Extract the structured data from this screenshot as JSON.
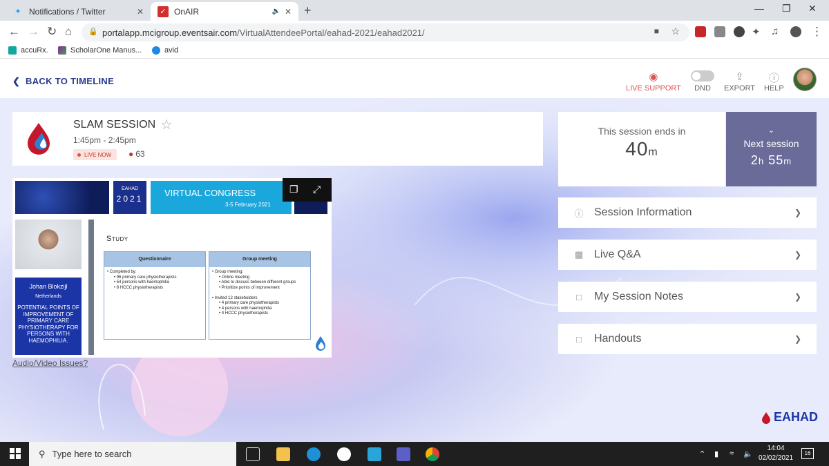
{
  "browser": {
    "tabs": [
      {
        "label": "Notifications / Twitter",
        "icon": "twitter-icon",
        "active": false
      },
      {
        "label": "OnAIR",
        "icon": "onair-icon",
        "active": true
      }
    ],
    "new_tab": "+",
    "url_prefix": "portalapp.mcigroup.eventsair.com",
    "url_rest": "/VirtualAttendeePortal/eahad-2021/eahad2021/",
    "bookmarks": [
      {
        "label": "accuRx.",
        "icon": "accurx-icon"
      },
      {
        "label": "ScholarOne Manus...",
        "icon": "scholarone-icon"
      },
      {
        "label": "avid",
        "icon": "avid-icon"
      }
    ]
  },
  "header": {
    "back_label": "BACK TO TIMELINE",
    "live_support": "LIVE SUPPORT",
    "dnd": "DND",
    "export": "EXPORT",
    "help": "HELP"
  },
  "session": {
    "title": "SLAM SESSION",
    "time": "1:45pm - 2:45pm",
    "live_badge": "LIVE NOW",
    "viewers": "63"
  },
  "video": {
    "banner_eahad": "EAHAD",
    "banner_year": "2021",
    "banner_congress": "VIRTUAL CONGRESS",
    "banner_dates": "3-5 February 2021",
    "speaker_name": "Johan Blokzijl",
    "speaker_country": "Netherlands",
    "speaker_topic": "POTENTIAL POINTS OF IMPROVEMENT OF PRIMARY CARE PHYSIOTHERAPY FOR PERSONS WITH HAEMOPHILIA.",
    "slide_title": "Study",
    "box1_header": "Questionnaire",
    "box1_lines": [
      {
        "text": "• Completed by:",
        "sub": false
      },
      {
        "text": "• 96 primary care physiotherapists",
        "sub": true
      },
      {
        "text": "• 54 persons with haemophilia",
        "sub": true
      },
      {
        "text": "• 8 HCCC physiotherapists",
        "sub": true
      }
    ],
    "box2_header": "Group meeting",
    "box2_lines": [
      {
        "text": "• Group meeting:",
        "sub": false
      },
      {
        "text": "• Online meeting",
        "sub": true
      },
      {
        "text": "• Able to discuss between different groups",
        "sub": true
      },
      {
        "text": "• Prioritize points of improvement",
        "sub": true
      },
      {
        "text": "",
        "sub": false
      },
      {
        "text": "• Invited 12 stakeholders",
        "sub": false
      },
      {
        "text": "• 4 primary care physiotherapists",
        "sub": true
      },
      {
        "text": "• 4 persons with haemophilia",
        "sub": true
      },
      {
        "text": "• 4 HCCC physiotherapists",
        "sub": true
      }
    ]
  },
  "av_issues": "Audio/Video Issues?",
  "timer": {
    "label": "This session ends in",
    "value": "40",
    "unit": "m"
  },
  "next_session": {
    "label": "Next session",
    "hours": "2",
    "minutes": "55",
    "h_unit": "h",
    "m_unit": "m"
  },
  "accordion": [
    {
      "label": "Session Information",
      "icon": "info-icon"
    },
    {
      "label": "Live Q&A",
      "icon": "chat-icon"
    },
    {
      "label": "My Session Notes",
      "icon": "notes-icon"
    },
    {
      "label": "Handouts",
      "icon": "handouts-icon"
    }
  ],
  "brand_logo": "EAHAD",
  "taskbar": {
    "search_placeholder": "Type here to search",
    "time": "14:04",
    "date": "02/02/2021",
    "notifications": "16"
  },
  "colors": {
    "accent": "#2a3a8c",
    "live_support": "#d9534f",
    "next_session_bg": "#6b6b9a",
    "eahad_blue": "#1b35a6"
  }
}
